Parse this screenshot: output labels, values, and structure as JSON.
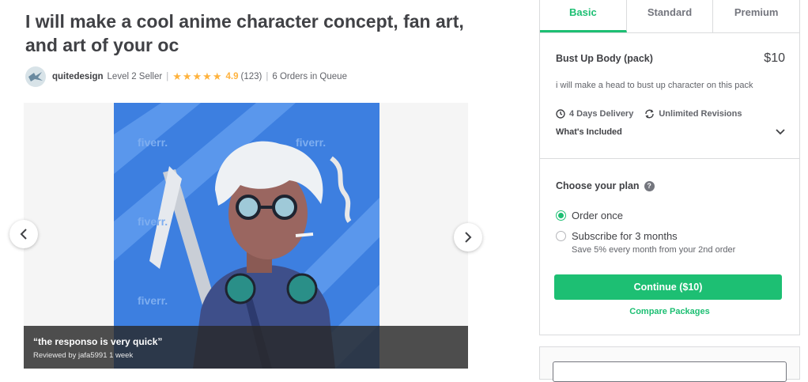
{
  "gig": {
    "title": "I will make a cool anime character concept, fan art, and art of your oc"
  },
  "seller": {
    "name": "quitedesign",
    "level": "Level 2 Seller",
    "stars": "★★★★★",
    "rating": "4.9",
    "reviews": "(123)",
    "queue": "6 Orders in Queue"
  },
  "gallery": {
    "review_quote": "“the responso is very quick”",
    "review_meta": "Reviewed by jafa5991 1 week",
    "watermark": "fiverr."
  },
  "package": {
    "tabs": [
      "Basic",
      "Standard",
      "Premium"
    ],
    "active_tab": "Basic",
    "name": "Bust Up Body (pack)",
    "price": "$10",
    "description": "i will make a head to bust up character on this pack",
    "delivery": "4 Days Delivery",
    "revisions": "Unlimited Revisions",
    "whats_included": "What's Included",
    "plan_title": "Choose your plan",
    "plan_option_once": "Order once",
    "plan_option_subscribe": "Subscribe for 3 months",
    "subscribe_note": "Save 5% every month from your 2nd order",
    "continue_label": "Continue ($10)",
    "compare_label": "Compare Packages"
  },
  "colors": {
    "accent": "#1dbf73",
    "star": "#ffb33e",
    "art_bg": "#3d7fe0"
  }
}
